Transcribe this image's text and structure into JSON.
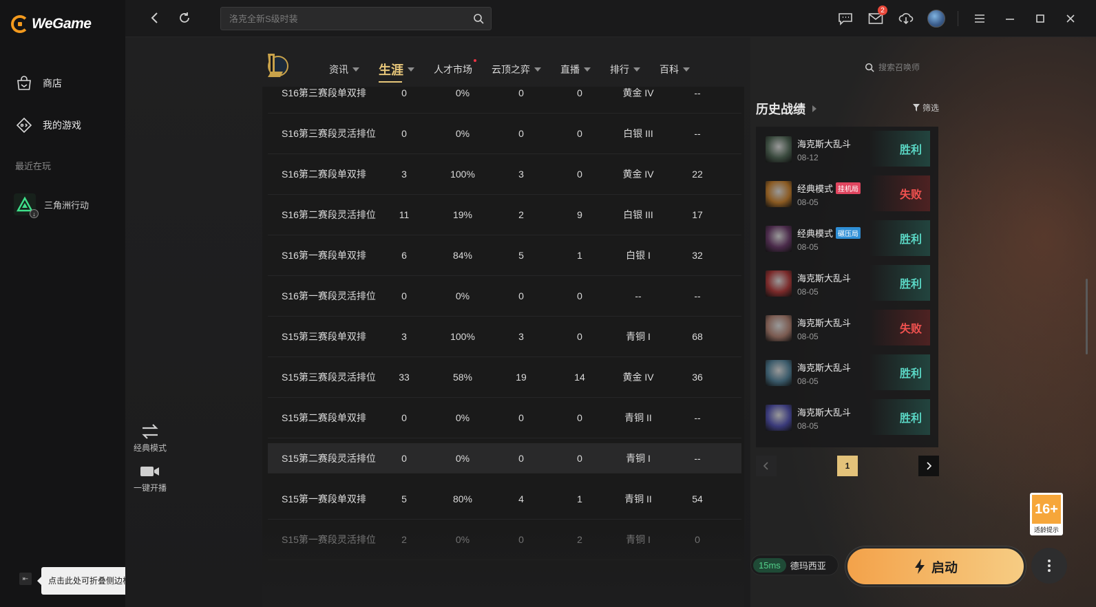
{
  "app": {
    "name": "WeGame"
  },
  "sidebar": {
    "items": [
      {
        "label": "商店",
        "icon": "shop-bag-icon"
      },
      {
        "label": "我的游戏",
        "icon": "gamepad-icon"
      }
    ],
    "recent_label": "最近在玩",
    "recent_game": {
      "label": "三角洲行动",
      "icon": "delta-force-icon"
    },
    "collapse_tip": "点击此处可折叠侧边栏"
  },
  "topbar": {
    "search_placeholder": "洛克全新S级时装",
    "mail_badge": "2"
  },
  "game_nav": {
    "items": [
      {
        "label": "资讯",
        "caret": true,
        "active": false,
        "dot": false
      },
      {
        "label": "生涯",
        "caret": true,
        "active": true,
        "dot": false
      },
      {
        "label": "人才市场",
        "caret": false,
        "active": false,
        "dot": true
      },
      {
        "label": "云顶之弈",
        "caret": true,
        "active": false,
        "dot": false
      },
      {
        "label": "直播",
        "caret": true,
        "active": false,
        "dot": false
      },
      {
        "label": "排行",
        "caret": true,
        "active": false,
        "dot": false
      },
      {
        "label": "百科",
        "caret": true,
        "active": false,
        "dot": false
      }
    ],
    "summoner_search_placeholder": "搜索召唤师"
  },
  "mode_panel": {
    "mode_label": "经典模式",
    "stream_label": "一键开播"
  },
  "ranked_table": {
    "rows": [
      [
        "S16第三赛段单双排",
        "0",
        "0%",
        "0",
        "0",
        "黄金 IV",
        "--"
      ],
      [
        "S16第三赛段灵活排位",
        "0",
        "0%",
        "0",
        "0",
        "白银 III",
        "--"
      ],
      [
        "S16第二赛段单双排",
        "3",
        "100%",
        "3",
        "0",
        "黄金 IV",
        "22"
      ],
      [
        "S16第二赛段灵活排位",
        "11",
        "19%",
        "2",
        "9",
        "白银 III",
        "17"
      ],
      [
        "S16第一赛段单双排",
        "6",
        "84%",
        "5",
        "1",
        "白银 I",
        "32"
      ],
      [
        "S16第一赛段灵活排位",
        "0",
        "0%",
        "0",
        "0",
        "--",
        "--"
      ],
      [
        "S15第三赛段单双排",
        "3",
        "100%",
        "3",
        "0",
        "青铜 I",
        "68"
      ],
      [
        "S15第三赛段灵活排位",
        "33",
        "58%",
        "19",
        "14",
        "黄金 IV",
        "36"
      ],
      [
        "S15第二赛段单双排",
        "0",
        "0%",
        "0",
        "0",
        "青铜 II",
        "--"
      ],
      [
        "S15第二赛段灵活排位",
        "0",
        "0%",
        "0",
        "0",
        "青铜 I",
        "--"
      ],
      [
        "S15第一赛段单双排",
        "5",
        "80%",
        "4",
        "1",
        "青铜 II",
        "54"
      ],
      [
        "S15第一赛段灵活排位",
        "2",
        "0%",
        "0",
        "2",
        "青铜 I",
        "0"
      ]
    ],
    "highlighted_row": 9
  },
  "history": {
    "title": "历史战绩",
    "filter_label": "筛选",
    "matches": [
      {
        "mode": "海克斯大乱斗",
        "tag": "",
        "tag_color": "",
        "date": "08-12",
        "result": "胜利",
        "win": true,
        "champ_color": "#3a4a3e"
      },
      {
        "mode": "经典模式",
        "tag": "挂机局",
        "tag_color": "#e0455f",
        "date": "08-05",
        "result": "失败",
        "win": false,
        "champ_color": "#8a5a22"
      },
      {
        "mode": "经典模式",
        "tag": "碾压局",
        "tag_color": "#2f8fd6",
        "date": "08-05",
        "result": "胜利",
        "win": true,
        "champ_color": "#4a2a4a"
      },
      {
        "mode": "海克斯大乱斗",
        "tag": "",
        "tag_color": "",
        "date": "08-05",
        "result": "胜利",
        "win": true,
        "champ_color": "#7a2a2a"
      },
      {
        "mode": "海克斯大乱斗",
        "tag": "",
        "tag_color": "",
        "date": "08-05",
        "result": "失败",
        "win": false,
        "champ_color": "#7a5a50"
      },
      {
        "mode": "海克斯大乱斗",
        "tag": "",
        "tag_color": "",
        "date": "08-05",
        "result": "胜利",
        "win": true,
        "champ_color": "#3a5a6a"
      },
      {
        "mode": "海克斯大乱斗",
        "tag": "",
        "tag_color": "",
        "date": "08-05",
        "result": "胜利",
        "win": true,
        "champ_color": "#3a3a7a"
      }
    ],
    "current_page": "1"
  },
  "age_rating": {
    "value": "16+",
    "note": "适龄提示"
  },
  "launch": {
    "ping": "15ms",
    "server": "德玛西亚",
    "button_label": "启动"
  }
}
